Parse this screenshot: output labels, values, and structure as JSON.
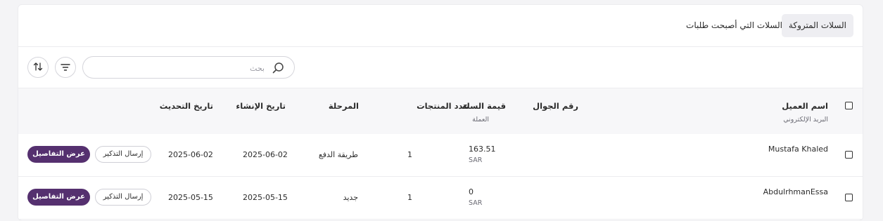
{
  "tabs": {
    "abandoned": "السلات المتروكة",
    "converted": "السلات التي أصبحت طلبات"
  },
  "search": {
    "placeholder": "بحث"
  },
  "colors": {
    "accent": "#55306f",
    "border": "#d5d5db"
  },
  "icons": {
    "search": "search-icon",
    "filter": "filter-icon",
    "sort": "sort-icon"
  },
  "table": {
    "headers": {
      "customer_name": "اسم العميل",
      "email": "البريد الإلكتروني",
      "phone": "رقم الجوال",
      "cart_value": "قيمة السلة",
      "currency": "العملة",
      "product_count": "عدد المنتجات",
      "stage": "المرحلة",
      "created_at": "تاريخ الإنشاء",
      "updated_at": "تاريخ التحديث"
    },
    "rows": [
      {
        "name": "Mustafa Khaled",
        "value": "163.51",
        "currency": "SAR",
        "count": "1",
        "stage": "طريقة الدفع",
        "created": "2025-06-02",
        "updated": "2025-06-02",
        "remind_label": "إرسال التذكير",
        "details_label": "عرض التفاصيل"
      },
      {
        "name": "AbdulrhmanEssa",
        "value": "0",
        "currency": "SAR",
        "count": "1",
        "stage": "جديد",
        "created": "2025-05-15",
        "updated": "2025-05-15",
        "remind_label": "إرسال التذكير",
        "details_label": "عرض التفاصيل"
      }
    ]
  }
}
